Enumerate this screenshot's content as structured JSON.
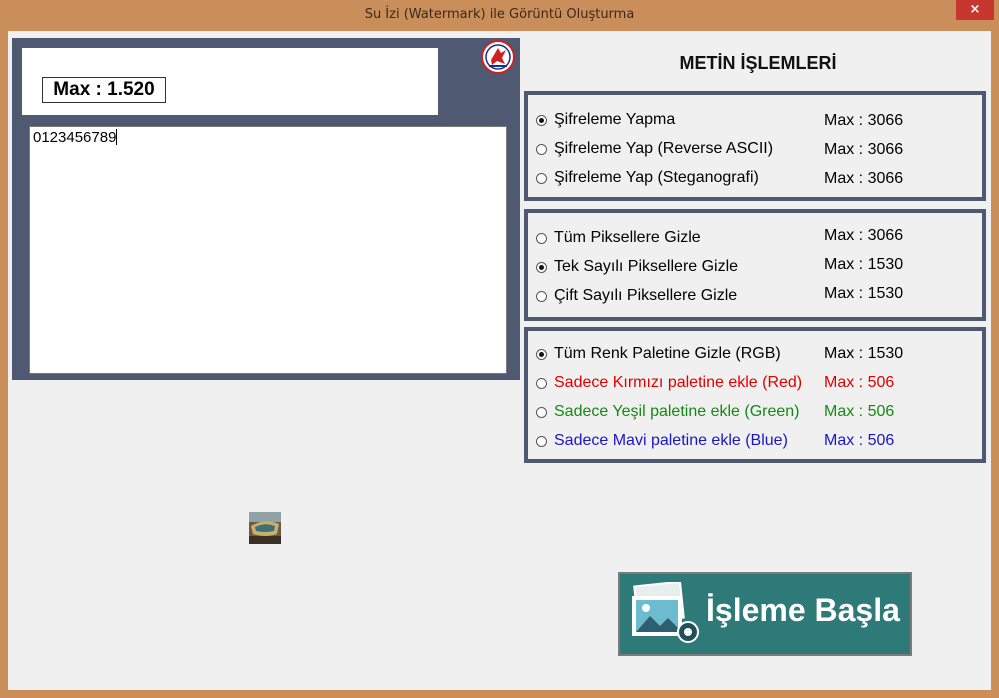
{
  "window": {
    "title": "Su İzi (Watermark) ile Görüntü Oluşturma",
    "close_glyph": "×"
  },
  "left": {
    "max_label": "Max : 1.520",
    "text_value": "0123456789"
  },
  "heading": "METİN İŞLEMLERİ",
  "encryption": [
    {
      "label": "Şifreleme Yapma",
      "max": "Max : 3066",
      "selected": true
    },
    {
      "label": "Şifreleme Yap (Reverse ASCII)",
      "max": "Max : 3066",
      "selected": false
    },
    {
      "label": "Şifreleme Yap (Steganografi)",
      "max": "Max : 3066",
      "selected": false
    }
  ],
  "pixels": [
    {
      "label": "Tüm Piksellere Gizle",
      "max": "Max : 3066",
      "selected": false
    },
    {
      "label": "Tek Sayılı Piksellere Gizle",
      "max": "Max : 1530",
      "selected": true
    },
    {
      "label": "Çift Sayılı Piksellere Gizle",
      "max": "Max : 1530",
      "selected": false
    }
  ],
  "palette": [
    {
      "label": "Tüm Renk Paletine Gizle (RGB)",
      "max": "Max : 1530",
      "selected": true,
      "color": "#000000"
    },
    {
      "label": "Sadece Kırmızı paletine ekle (Red)",
      "max": "Max : 506",
      "selected": false,
      "color": "#e00000"
    },
    {
      "label": "Sadece Yeşil paletine ekle (Green)",
      "max": "Max : 506",
      "selected": false,
      "color": "#138a13"
    },
    {
      "label": "Sadece Mavi paletine ekle (Blue)",
      "max": "Max : 506",
      "selected": false,
      "color": "#1a16c8"
    }
  ],
  "start_button": {
    "label": "İşleme Başla",
    "icon": "image-gear-icon"
  },
  "icons": {
    "logo": "university-logo-icon",
    "thumbnail": "boat-thumbnail-image"
  }
}
